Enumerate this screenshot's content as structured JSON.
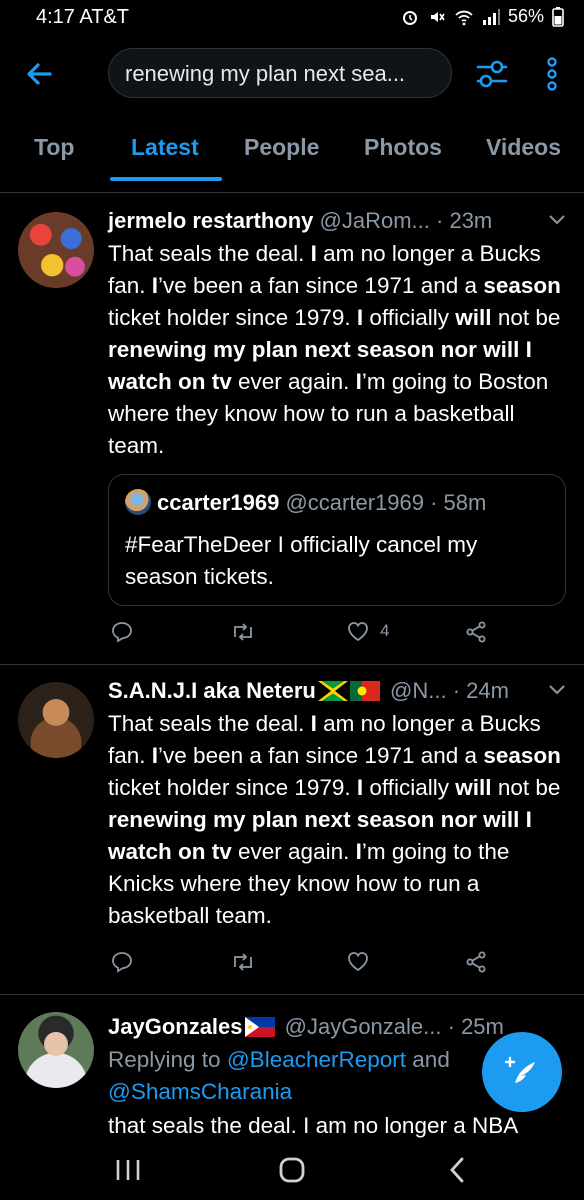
{
  "status": {
    "time": "4:17 AT&T",
    "battery": "56%"
  },
  "search": {
    "query": "renewing my plan next sea..."
  },
  "tabs": [
    {
      "label": "Top"
    },
    {
      "label": "Latest"
    },
    {
      "label": "People"
    },
    {
      "label": "Photos"
    },
    {
      "label": "Videos"
    }
  ],
  "tweets": [
    {
      "name": "jermelo restarthony",
      "handle": "@JaRom...",
      "time": "· 23m",
      "quote": {
        "name": "ccarter1969",
        "handle": "@ccarter1969",
        "time": "· 58m",
        "text": "#FearTheDeer I officially cancel my season tickets."
      },
      "likes": "4"
    },
    {
      "name": "S.A.N.J.I aka Neteru",
      "handle": "@N...",
      "time": "· 24m"
    },
    {
      "name": "JayGonzales",
      "handle": "@JayGonzale...",
      "time": "· 25m",
      "replying_prefix": "Replying to",
      "reply_to_1": "@BleacherReport",
      "reply_and": "and",
      "reply_to_2": "@ShamsCharania",
      "text": "that seals the deal. I am no longer a NBA"
    }
  ],
  "tweet1_body": [
    {
      "t": "That seals the deal. ",
      "b": false
    },
    {
      "t": "I",
      "b": true
    },
    {
      "t": " am no longer a Bucks fan. ",
      "b": false
    },
    {
      "t": "I",
      "b": true
    },
    {
      "t": "’ve been a fan since 1971 and a ",
      "b": false
    },
    {
      "t": "season",
      "b": true
    },
    {
      "t": " ticket holder since 1979. ",
      "b": false
    },
    {
      "t": "I",
      "b": true
    },
    {
      "t": " officially ",
      "b": false
    },
    {
      "t": "will",
      "b": true
    },
    {
      "t": " not be ",
      "b": false
    },
    {
      "t": "renewing my plan next season nor will I watch on tv",
      "b": true
    },
    {
      "t": " ever again. ",
      "b": false
    },
    {
      "t": "I",
      "b": true
    },
    {
      "t": "’m going to Boston where they know how to run a basketball team.",
      "b": false
    }
  ],
  "tweet2_body": [
    {
      "t": "That seals the deal. ",
      "b": false
    },
    {
      "t": "I",
      "b": true
    },
    {
      "t": " am no longer a Bucks fan. ",
      "b": false
    },
    {
      "t": "I",
      "b": true
    },
    {
      "t": "’ve been a fan since 1971 and a ",
      "b": false
    },
    {
      "t": "season",
      "b": true
    },
    {
      "t": " ticket holder since 1979. ",
      "b": false
    },
    {
      "t": "I",
      "b": true
    },
    {
      "t": " officially ",
      "b": false
    },
    {
      "t": "will",
      "b": true
    },
    {
      "t": " not be ",
      "b": false
    },
    {
      "t": "renewing my plan next season nor will I watch on tv",
      "b": true
    },
    {
      "t": " ever again. ",
      "b": false
    },
    {
      "t": "I",
      "b": true
    },
    {
      "t": "’m going to the Knicks where they know how to run a basketball team.",
      "b": false
    }
  ],
  "colors": {
    "accent": "#1d9bf0",
    "muted": "#8b98a5",
    "divider": "#2f3336",
    "background": "#000000"
  },
  "icons": [
    "back-arrow-icon",
    "filter-icon",
    "more-vertical-icon",
    "reply-icon",
    "retweet-icon",
    "like-icon",
    "share-icon",
    "compose-icon",
    "chevron-down-icon"
  ]
}
